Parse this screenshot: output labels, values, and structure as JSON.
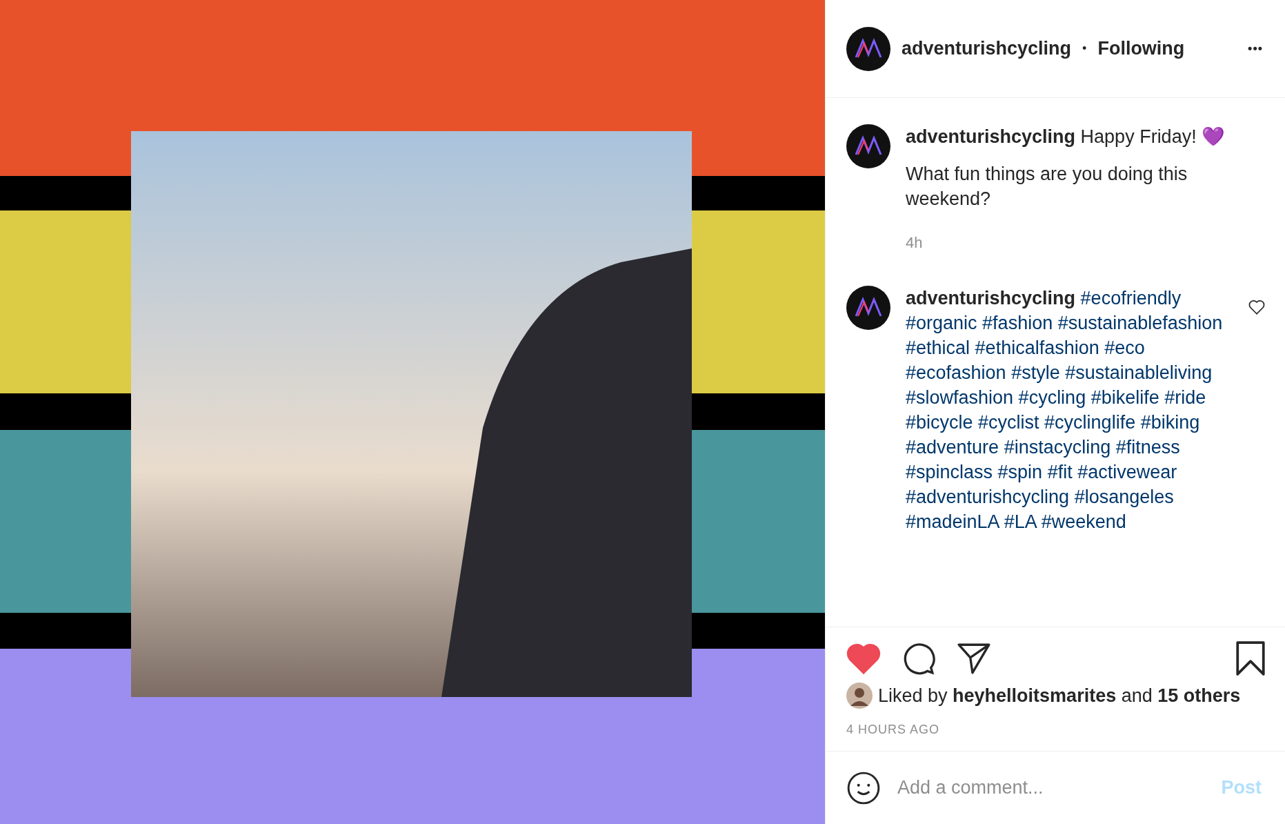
{
  "post_header": {
    "username": "adventurishcycling",
    "separator": "•",
    "follow_status": "Following",
    "more": "•••"
  },
  "caption": {
    "username": "adventurishcycling",
    "text": "Happy Friday! 💜",
    "body": "What fun things are you doing this weekend?",
    "time": "4h"
  },
  "comment": {
    "username": "adventurishcycling",
    "liked": false,
    "hashtags": [
      "#ecofriendly",
      "#organic",
      "#fashion",
      "#sustainablefashion",
      "#ethical",
      "#ethicalfashion",
      "#eco",
      "#ecofashion",
      "#style",
      "#sustainableliving",
      "#slowfashion",
      "#cycling",
      "#bikelife",
      "#ride",
      "#bicycle",
      "#cyclist",
      "#cyclinglife",
      "#biking",
      "#adventure",
      "#instacycling",
      "#fitness",
      "#spinclass",
      "#spin",
      "#fit",
      "#activewear",
      "#adventurishcycling",
      "#losangeles",
      "#madeinLA",
      "#LA",
      "#weekend"
    ]
  },
  "actions": {
    "liked": true,
    "saved": false
  },
  "likes": "Liked by **heyhelloitsmarites** and **15 others**",
  "timestamp": "4 HOURS AGO",
  "add_comment": {
    "placeholder": "Add a comment...",
    "button": "Post"
  }
}
